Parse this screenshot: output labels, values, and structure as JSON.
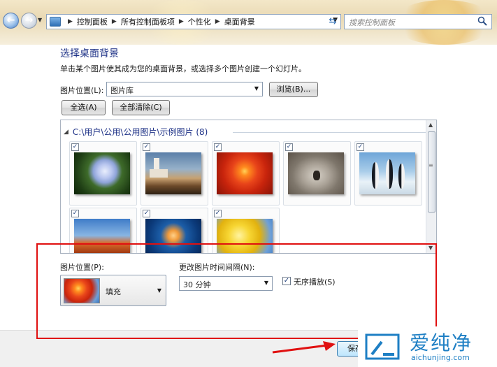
{
  "address_bar": {
    "crumbs": [
      "控制面板",
      "所有控制面板项",
      "个性化",
      "桌面背景"
    ],
    "search_placeholder": "搜索控制面板"
  },
  "page": {
    "title": "选择桌面背景",
    "subtitle": "单击某个图片使其成为您的桌面背景，或选择多个图片创建一个幻灯片。",
    "location_label": "图片位置(L):",
    "location_value": "图片库",
    "browse_label": "浏览(B)...",
    "select_all_label": "全选(A)",
    "clear_all_label": "全部清除(C)"
  },
  "picture_list": {
    "group_title": "C:\\用户\\公用\\公用图片\\示例图片 (8)",
    "items": [
      {
        "name": "hydrangea-thumbnail",
        "checked": true
      },
      {
        "name": "lighthouse-thumbnail",
        "checked": true
      },
      {
        "name": "chrysanthemum-thumbnail",
        "checked": true
      },
      {
        "name": "koala-thumbnail",
        "checked": true
      },
      {
        "name": "penguins-thumbnail",
        "checked": true
      },
      {
        "name": "desert-thumbnail",
        "checked": true
      },
      {
        "name": "jellyfish-thumbnail",
        "checked": true
      },
      {
        "name": "tulips-thumbnail",
        "checked": true
      }
    ],
    "check_mark": "✓"
  },
  "options": {
    "position_label": "图片位置(P):",
    "position_value": "填充",
    "interval_label": "更改图片时间间隔(N):",
    "interval_value": "30 分钟",
    "shuffle_label": "无序播放(S)",
    "shuffle_checked": true
  },
  "footer": {
    "save_label": "保存"
  },
  "watermark": {
    "brand": "爱纯净",
    "url": "aichunjing.com"
  },
  "colors": {
    "title_blue": "#1e3287",
    "annotation_red": "#e01010",
    "watermark_blue": "#1e7fc4"
  }
}
